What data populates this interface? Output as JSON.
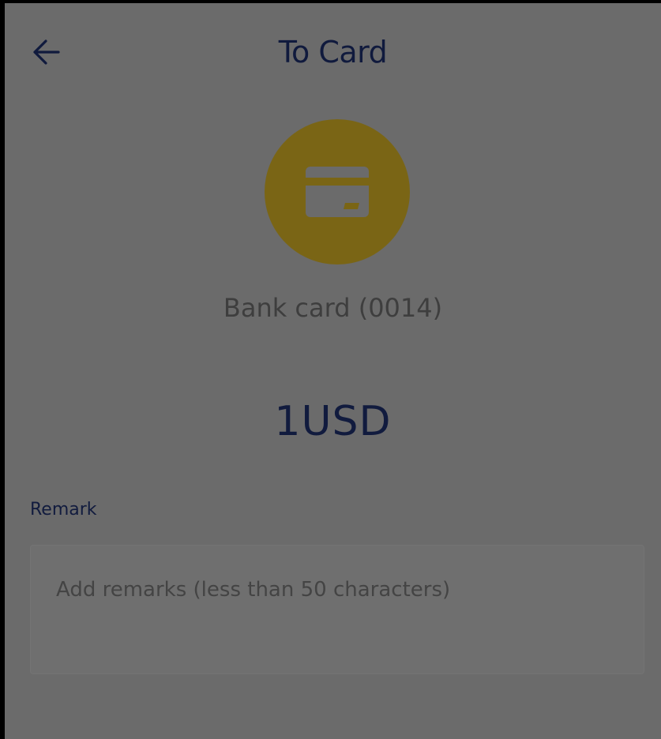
{
  "header": {
    "title": "To Card"
  },
  "icons": {
    "back": "arrow-left-icon",
    "card": "credit-card-icon"
  },
  "colors": {
    "overlay": "#6b6b6b",
    "icon_circle": "#7a6515",
    "title_text": "#101a3d"
  },
  "card": {
    "label": "Bank card (0014)"
  },
  "amount": {
    "value": "1USD"
  },
  "remark": {
    "label": "Remark",
    "value": "",
    "placeholder": "Add remarks (less than 50 characters)"
  }
}
